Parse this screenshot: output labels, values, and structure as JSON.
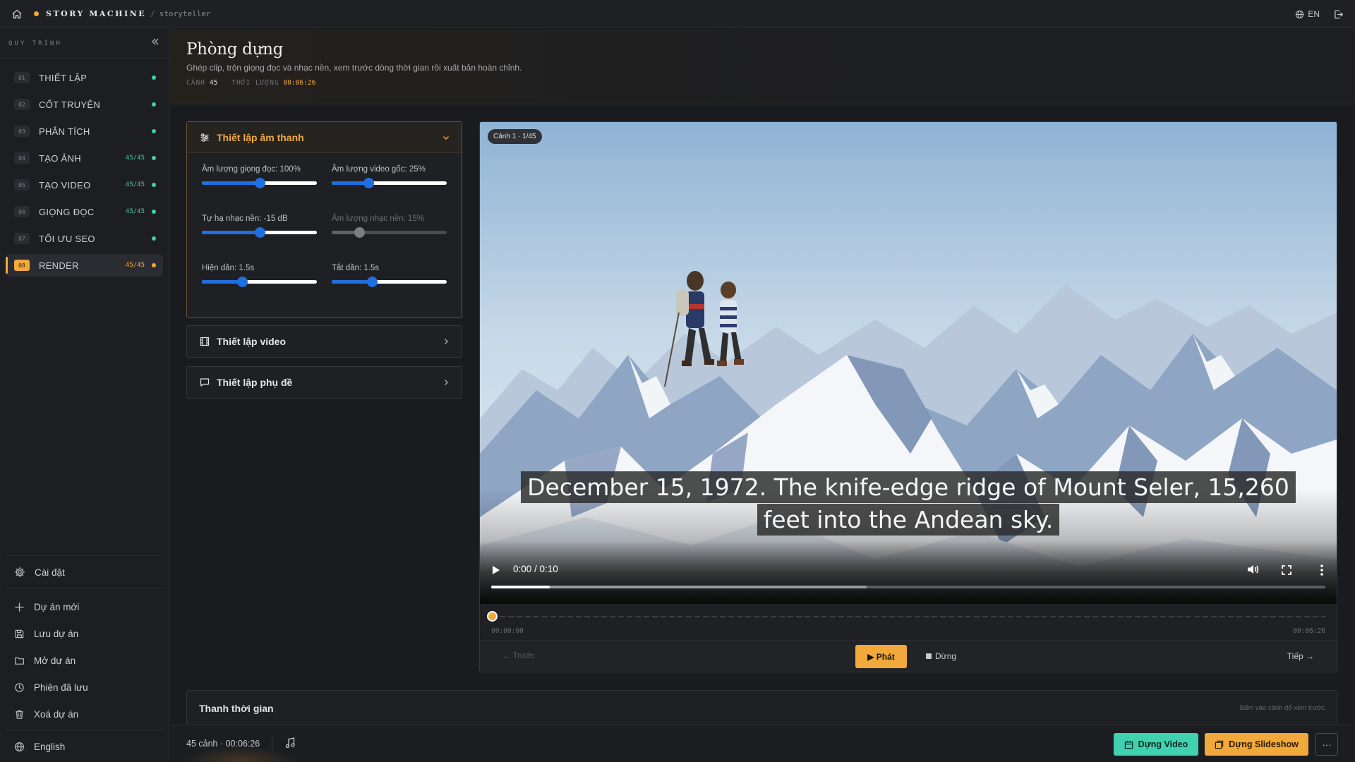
{
  "topbar": {
    "brand": "STORY MACHINE",
    "separator": "/",
    "subtitle": "storyteller",
    "language": "EN"
  },
  "sidebar": {
    "title": "QUY TRÌNH",
    "steps": [
      {
        "num": "01",
        "label": "THIẾT LẬP",
        "count": ""
      },
      {
        "num": "02",
        "label": "CỐT TRUYỆN",
        "count": ""
      },
      {
        "num": "03",
        "label": "PHÂN TÍCH",
        "count": ""
      },
      {
        "num": "04",
        "label": "TẠO ẢNH",
        "count": "45/45"
      },
      {
        "num": "05",
        "label": "TẠO VIDEO",
        "count": "45/45"
      },
      {
        "num": "06",
        "label": "GIỌNG ĐỌC",
        "count": "45/45"
      },
      {
        "num": "07",
        "label": "TỐI ƯU SEO",
        "count": ""
      },
      {
        "num": "08",
        "label": "RENDER",
        "count": "45/45"
      }
    ],
    "settings": "Cài đặt",
    "actions": [
      "Dự án mới",
      "Lưu dự án",
      "Mở dự án",
      "Phiên đã lưu",
      "Xoá dự án"
    ],
    "language": "English"
  },
  "page": {
    "title": "Phòng dựng",
    "description": "Ghép clip, trộn giọng đọc và nhạc nền, xem trước dòng thời gian rồi xuất bản hoàn chỉnh.",
    "scenes_label": "CẢNH",
    "scenes_value": "45",
    "duration_label": "THỜI LƯỢNG",
    "duration_value": "00:06:26"
  },
  "audio_settings": {
    "title": "Thiết lập âm thanh",
    "sliders": [
      {
        "label": "Âm lượng giọng đọc: 100%",
        "value": 0.5,
        "disabled": false
      },
      {
        "label": "Âm lượng video gốc: 25%",
        "value": 0.32,
        "disabled": false
      },
      {
        "label": "Tự hạ nhạc nền: -15 dB",
        "value": 0.5,
        "disabled": false
      },
      {
        "label": "Âm lượng nhạc nền: 15%",
        "value": 0.24,
        "disabled": true
      },
      {
        "label": "Hiện dần: 1.5s",
        "value": 0.35,
        "disabled": false
      },
      {
        "label": "Tắt dần: 1.5s",
        "value": 0.35,
        "disabled": false
      }
    ]
  },
  "video_settings": {
    "title": "Thiết lập video"
  },
  "subtitle_settings": {
    "title": "Thiết lập phụ đề"
  },
  "player": {
    "scene_badge": "Cảnh 1 · 1/45",
    "caption_line1": "December 15, 1972. The knife-edge ridge of Mount Seler, 15,260",
    "caption_line2": "feet into the Andean sky.",
    "time": "0:00 / 0:10",
    "played_fraction": 0.07,
    "buffered_fraction": 0.45,
    "timeline_start": "00:00:00",
    "timeline_end": "00:06:26",
    "prev_label": "← Trước",
    "play_label": "▶ Phát",
    "stop_label": "Dừng",
    "next_label": "Tiếp →"
  },
  "timeline_section": {
    "title": "Thanh thời gian",
    "hint": "Bấm vào cảnh để xem trước"
  },
  "bottom_bar": {
    "info": "45 cảnh · 00:06:26",
    "build_video": "Dựng Video",
    "build_slideshow": "Dựng Slideshow",
    "more": "···"
  },
  "colors": {
    "accent": "#f2a93b",
    "success": "#3ed1a3",
    "slider": "#1f6fe0"
  }
}
